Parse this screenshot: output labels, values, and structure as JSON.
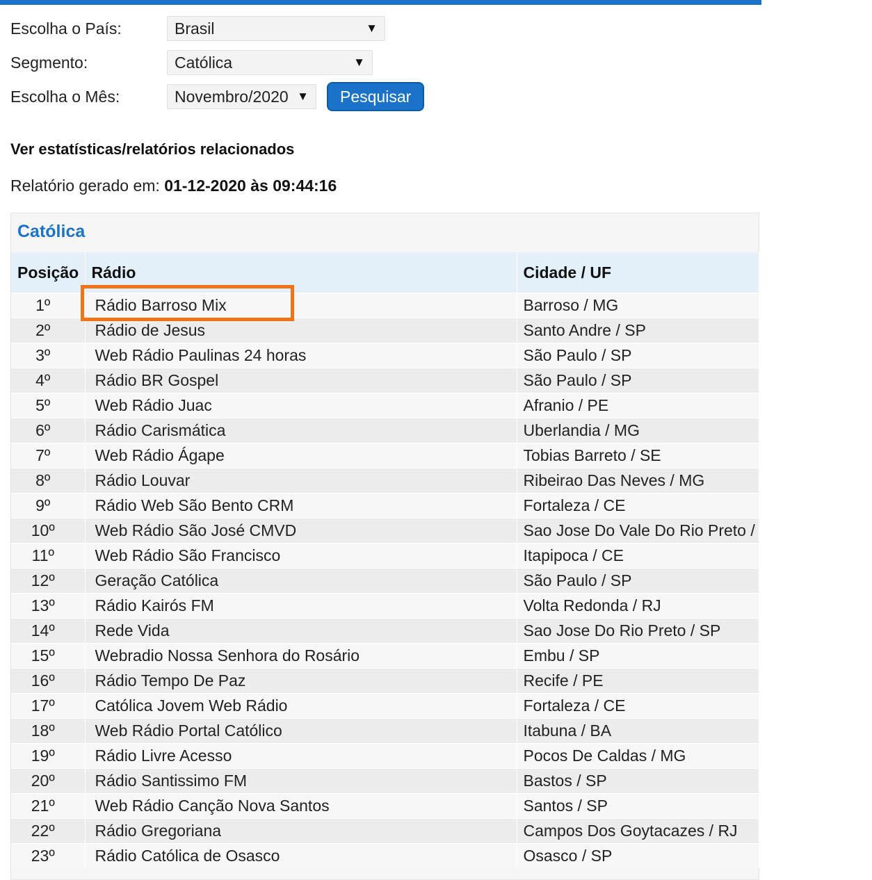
{
  "form": {
    "country_label": "Escolha o País:",
    "country_value": "Brasil",
    "segment_label": "Segmento:",
    "segment_value": "Católica",
    "month_label": "Escolha o Mês:",
    "month_value": "Novembro/2020",
    "search_button": "Pesquisar"
  },
  "related_link": "Ver estatísticas/relatórios relacionados",
  "report": {
    "generated_label": "Relatório gerado em:",
    "generated_value": "01-12-2020 às 09:44:16"
  },
  "panel": {
    "title": "Católica",
    "columns": [
      "Posição",
      "Rádio",
      "Cidade / UF"
    ],
    "rows": [
      {
        "pos": "1º",
        "radio": "Rádio Barroso Mix",
        "city": "Barroso / MG"
      },
      {
        "pos": "2º",
        "radio": "Rádio de Jesus",
        "city": "Santo Andre / SP"
      },
      {
        "pos": "3º",
        "radio": "Web Rádio Paulinas 24 horas",
        "city": "São Paulo / SP"
      },
      {
        "pos": "4º",
        "radio": "Rádio BR Gospel",
        "city": "São Paulo / SP"
      },
      {
        "pos": "5º",
        "radio": "Web Rádio Juac",
        "city": "Afranio / PE"
      },
      {
        "pos": "6º",
        "radio": "Rádio Carismática",
        "city": "Uberlandia / MG"
      },
      {
        "pos": "7º",
        "radio": "Web Rádio Ágape",
        "city": "Tobias Barreto / SE"
      },
      {
        "pos": "8º",
        "radio": "Rádio Louvar",
        "city": "Ribeirao Das Neves / MG"
      },
      {
        "pos": "9º",
        "radio": "Rádio Web São Bento CRM",
        "city": "Fortaleza / CE"
      },
      {
        "pos": "10º",
        "radio": "Web Rádio São José CMVD",
        "city": "Sao Jose Do Vale Do Rio Preto /"
      },
      {
        "pos": "11º",
        "radio": "Web Rádio São Francisco",
        "city": "Itapipoca / CE"
      },
      {
        "pos": "12º",
        "radio": "Geração Católica",
        "city": "São Paulo / SP"
      },
      {
        "pos": "13º",
        "radio": "Rádio Kairós FM",
        "city": "Volta Redonda / RJ"
      },
      {
        "pos": "14º",
        "radio": "Rede Vida",
        "city": "Sao Jose Do Rio Preto / SP"
      },
      {
        "pos": "15º",
        "radio": "Webradio Nossa Senhora do Rosário",
        "city": "Embu / SP"
      },
      {
        "pos": "16º",
        "radio": "Rádio Tempo De Paz",
        "city": "Recife / PE"
      },
      {
        "pos": "17º",
        "radio": "Católica Jovem Web Rádio",
        "city": "Fortaleza / CE"
      },
      {
        "pos": "18º",
        "radio": "Web Rádio Portal Católico",
        "city": "Itabuna / BA"
      },
      {
        "pos": "19º",
        "radio": "Rádio Livre Acesso",
        "city": "Pocos De Caldas / MG"
      },
      {
        "pos": "20º",
        "radio": "Rádio Santissimo FM",
        "city": "Bastos / SP"
      },
      {
        "pos": "21º",
        "radio": "Web Rádio Canção Nova Santos",
        "city": "Santos / SP"
      },
      {
        "pos": "22º",
        "radio": "Rádio Gregoriana",
        "city": "Campos Dos Goytacazes / RJ"
      },
      {
        "pos": "23º",
        "radio": "Rádio Católica de Osasco",
        "city": "Osasco / SP"
      }
    ]
  },
  "colors": {
    "accent": "#1a73c8",
    "highlight": "#f47216",
    "header_bg": "#e3f0fa"
  }
}
